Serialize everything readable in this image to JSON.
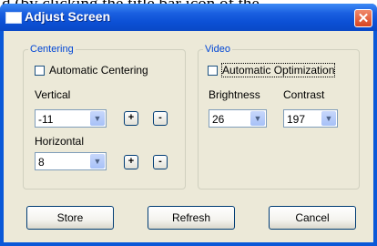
{
  "background_text": "d (by clicking the title bar icon of the",
  "window": {
    "title": "Adjust Screen",
    "close_glyph": "✕"
  },
  "centering": {
    "legend": "Centering",
    "auto_label": "Automatic Centering",
    "auto_checked": false,
    "vertical_label": "Vertical",
    "vertical_value": "-11",
    "horizontal_label": "Horizontal",
    "horizontal_value": "8",
    "plus": "+",
    "minus": "-"
  },
  "video": {
    "legend": "Video",
    "auto_label": "Automatic Optimization",
    "auto_checked": false,
    "brightness_label": "Brightness",
    "brightness_value": "26",
    "contrast_label": "Contrast",
    "contrast_value": "197"
  },
  "buttons": {
    "store": "Store",
    "refresh": "Refresh",
    "cancel": "Cancel"
  },
  "colors": {
    "titlebar": "#0b4fd4",
    "client": "#ece9d8",
    "legend": "#0046d5",
    "close": "#d9441f"
  }
}
